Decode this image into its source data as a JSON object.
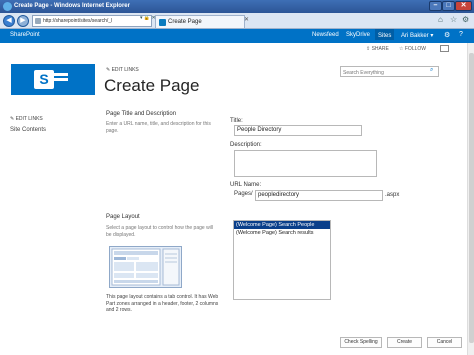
{
  "window": {
    "title": "Create Page - Windows Internet Explorer"
  },
  "browser": {
    "address": "http://sharepoint/sites/search/_l",
    "address_tools": "▾ 🔒 ✕",
    "tab_title": "Create Page"
  },
  "suitebar": {
    "brand": "SharePoint",
    "links": [
      "Newsfeed",
      "SkyDrive",
      "Sites"
    ],
    "user": "Ari Bakker ▾",
    "gear": "⚙",
    "help": "?"
  },
  "actions": {
    "share": "SHARE",
    "follow": "FOLLOW"
  },
  "search": {
    "placeholder": "Search Everything"
  },
  "header": {
    "edit_links": "EDIT LINKS",
    "title": "Create Page"
  },
  "sidebar": {
    "edit_links": "EDIT LINKS",
    "site_contents": "Site Contents"
  },
  "section_title": {
    "heading": "Page Title and Description",
    "description": "Enter a URL name, title, and description for this page."
  },
  "fields": {
    "title_label": "Title:",
    "title_value": "People Directory",
    "description_label": "Description:",
    "url_label": "URL Name:",
    "url_prefix": "Pages/",
    "url_value": "peopledirectory",
    "url_suffix": ".aspx"
  },
  "section_layout": {
    "heading": "Page Layout",
    "description": "Select a page layout to control how the page will be displayed.",
    "layout_description": "This page layout contains a tab control. It has Web Part zones arranged in a header, footer, 2 columns and 2 rows.",
    "options": [
      "(Welcome Page) Search People",
      "(Welcome Page) Search results"
    ],
    "selected_index": 0
  },
  "buttons": {
    "spelling": "Check Spelling",
    "create": "Create",
    "cancel": "Cancel"
  },
  "colors": {
    "accent": "#0072c6",
    "selected": "#0a3f8a"
  }
}
